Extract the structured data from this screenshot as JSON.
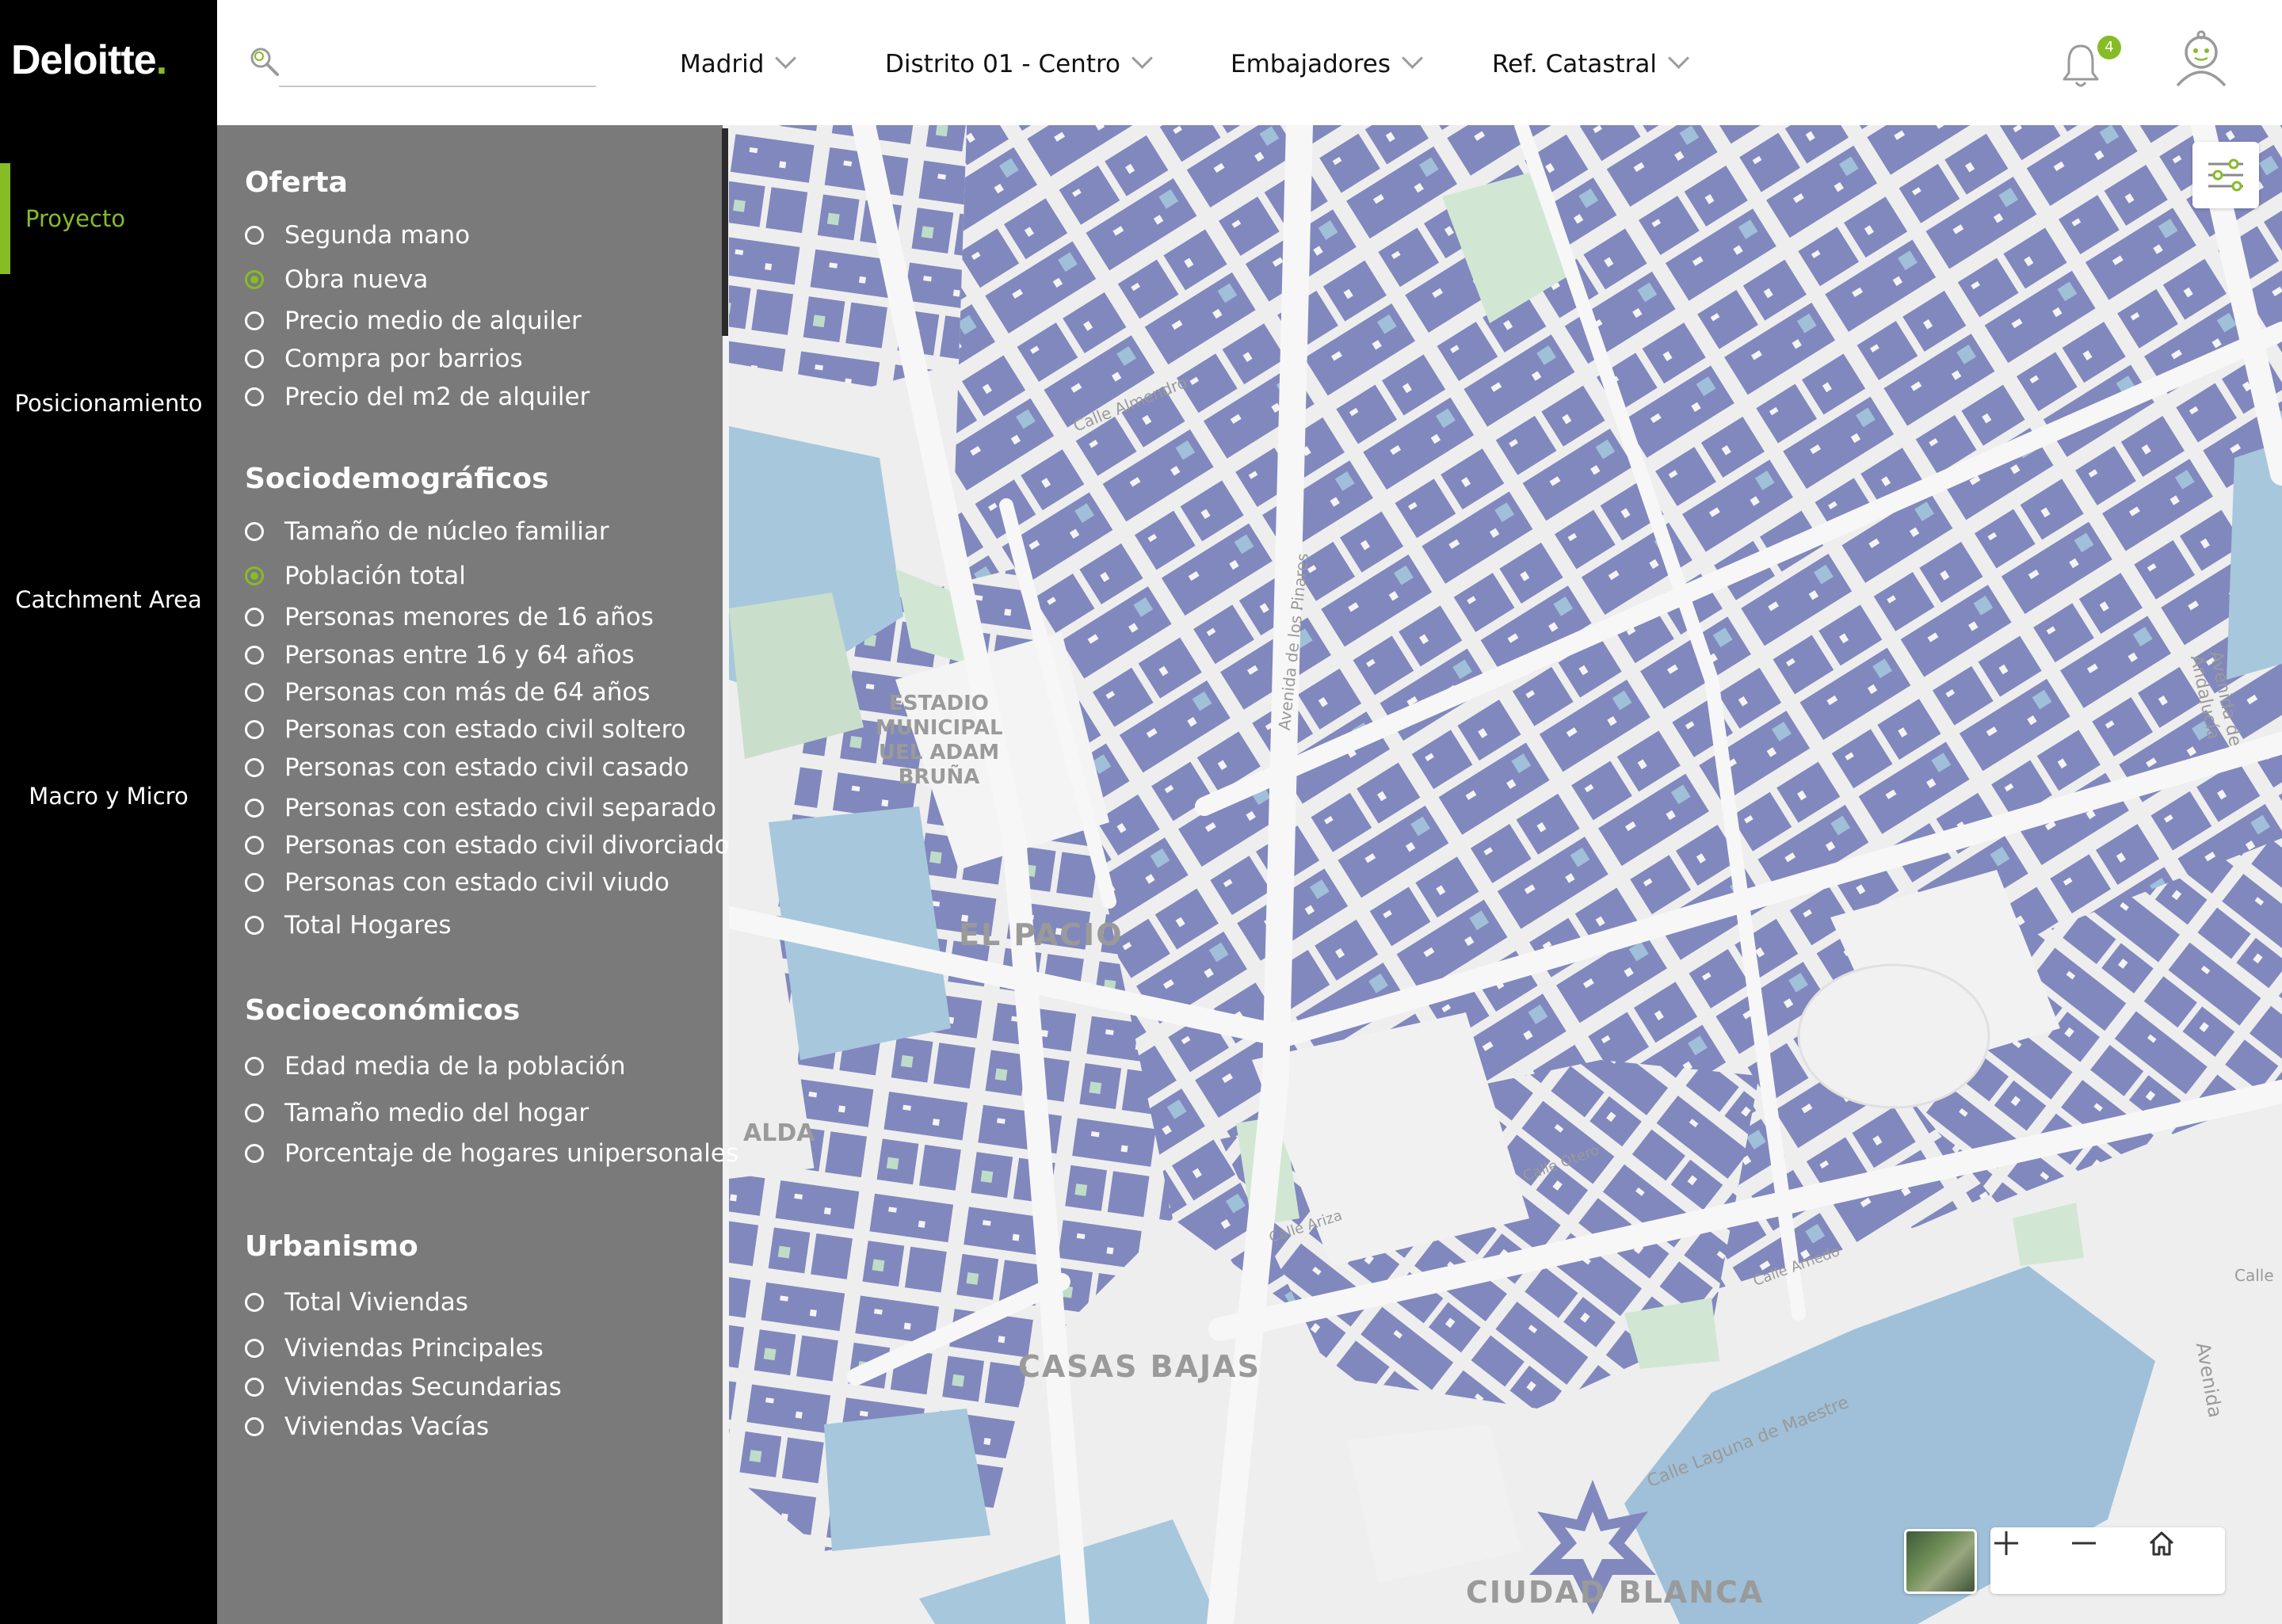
{
  "brand": {
    "name": "Deloitte",
    "dot": "."
  },
  "nav": {
    "items": [
      {
        "label": "Proyecto"
      },
      {
        "label": "Posicionamiento"
      },
      {
        "label": "Catchment Area"
      },
      {
        "label": "Macro y Micro"
      }
    ],
    "active": "Proyecto"
  },
  "header": {
    "search_value": "",
    "dropdowns": [
      {
        "label": "Madrid"
      },
      {
        "label": "Distrito 01 - Centro"
      },
      {
        "label": "Embajadores"
      },
      {
        "label": "Ref. Catastral"
      }
    ],
    "notification_count": "4"
  },
  "panel": {
    "sections": [
      {
        "title": "Oferta",
        "options": [
          {
            "label": "Segunda mano",
            "selected": false
          },
          {
            "label": "Obra nueva",
            "selected": true
          },
          {
            "label": "Precio medio de alquiler",
            "selected": false
          },
          {
            "label": "Compra por barrios",
            "selected": false
          },
          {
            "label": "Precio del m2 de alquiler",
            "selected": false
          }
        ]
      },
      {
        "title": "Sociodemográficos",
        "options": [
          {
            "label": "Tamaño de núcleo familiar",
            "selected": false
          },
          {
            "label": "Población total",
            "selected": true
          },
          {
            "label": "Personas menores de 16 años",
            "selected": false
          },
          {
            "label": "Personas entre 16 y 64 años",
            "selected": false
          },
          {
            "label": "Personas con más de 64 años",
            "selected": false
          },
          {
            "label": "Personas con estado civil soltero",
            "selected": false
          },
          {
            "label": "Personas con estado civil casado",
            "selected": false
          },
          {
            "label": "Personas con estado civil separado",
            "selected": false
          },
          {
            "label": "Personas con estado civil divorciado",
            "selected": false
          },
          {
            "label": "Personas con estado civil viudo",
            "selected": false
          },
          {
            "label": "Total Hogares",
            "selected": false
          }
        ]
      },
      {
        "title": "Socioeconómicos",
        "options": [
          {
            "label": "Edad media de la población",
            "selected": false
          },
          {
            "label": "Tamaño medio del hogar",
            "selected": false
          },
          {
            "label": "Porcentaje de hogares unipersonales",
            "selected": false
          }
        ]
      },
      {
        "title": "Urbanismo",
        "options": [
          {
            "label": "Total Viviendas",
            "selected": false
          },
          {
            "label": "Viviendas Principales",
            "selected": false
          },
          {
            "label": "Viviendas Secundarias",
            "selected": false
          },
          {
            "label": "Viviendas Vacías",
            "selected": false
          }
        ]
      }
    ]
  },
  "map": {
    "labels": [
      "ESTADIO",
      "MUNICIPAL",
      "UEL ADAM",
      "BRUÑA",
      "EL PACIO",
      "CASAS BAJAS",
      "CIUDAD BLANCA",
      "Calle Almendro",
      "Avenida de los Pinares",
      "Avenida de Andalucía",
      "Calle Laguna de Maestre",
      "Calle Ariza",
      "Calle Otero",
      "Calle Arnedo",
      "Avenida",
      "Calle",
      "ALDA"
    ]
  },
  "colors": {
    "brand_green": "#86bc25",
    "panel_gray": "#7a7a7a",
    "building_dark": "#8188bd",
    "building_light": "#9fc0d8",
    "park_green": "#d2e6d4"
  },
  "icons": {
    "search": "search-icon",
    "bell": "bell-icon",
    "user": "user-icon",
    "layers": "layers-icon",
    "plus": "plus-icon",
    "minus": "minus-icon",
    "home": "home-icon"
  }
}
